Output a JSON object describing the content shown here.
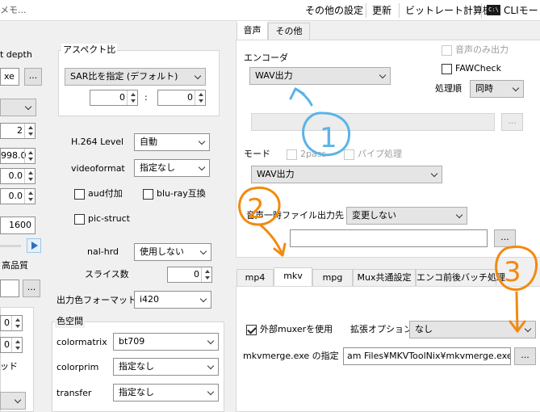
{
  "topbar": {
    "left_fragment": "メモ...",
    "buttons": [
      "その他の設定",
      "更新",
      "ビットレート計算機",
      "CLIモード"
    ],
    "cli_icon_text": "C:\\"
  },
  "left": {
    "bit_depth_label": "t depth",
    "exe_value": "xe",
    "browse": "...",
    "spin_values": [
      "2",
      "998.0",
      "0.0",
      "0.0"
    ],
    "field_1600": "1600",
    "quality_label": "高品質",
    "small_spins": [
      "0",
      "0"
    ],
    "thread_label": "ッド"
  },
  "aspect": {
    "group_label": "アスペクト比",
    "combo": "SAR比を指定 (デフォルト)",
    "spin_a": "0",
    "colon": ":",
    "spin_b": "0"
  },
  "h264": {
    "level_label": "H.264 Level",
    "level_value": "自動",
    "videoformat_label": "videoformat",
    "videoformat_value": "指定なし",
    "aud_label": "aud付加",
    "bluray_label": "blu-ray互換",
    "picstruct_label": "pic-struct",
    "nalhrd_label": "nal-hrd",
    "nalhrd_value": "使用しない",
    "slices_label": "スライス数",
    "slices_value": "0",
    "outcolor_label": "出力色フォーマット",
    "outcolor_value": "i420"
  },
  "colorspace": {
    "group_label": "色空間",
    "rows": [
      {
        "label": "colormatrix",
        "value": "bt709"
      },
      {
        "label": "colorprim",
        "value": "指定なし"
      },
      {
        "label": "transfer",
        "value": "指定なし"
      }
    ]
  },
  "audio": {
    "tabs": [
      "音声",
      "その他"
    ],
    "encoder_label": "エンコーダ",
    "encoder_value": "WAV出力",
    "audio_only_label": "音声のみ出力",
    "fawcheck_label": "FAWCheck",
    "order_label": "処理順",
    "order_value": "同時",
    "path_browse": "...",
    "mode_label": "モード",
    "twopass_label": "2pass",
    "pipe_label": "パイプ処理",
    "mode_value": "WAV出力",
    "temp_label": "音声一時ファイル出力先",
    "temp_value": "変更しない",
    "temp_browse": "..."
  },
  "mux": {
    "tabs": [
      "mp4",
      "mkv",
      "mpg",
      "Mux共通設定",
      "エンコ前後バッチ処理"
    ],
    "external_muxer_label": "外部muxerを使用",
    "ext_option_label": "拡張オプション",
    "ext_option_value": "なし",
    "mkvmerge_label": "mkvmerge.exe の指定",
    "mkvmerge_value": "am Files¥MKVToolNix¥mkvmerge.exe",
    "mkvmerge_browse": "..."
  },
  "annotations": {
    "num1": "1",
    "num2": "2",
    "num3": "3",
    "color_blue": "#5ab4e8",
    "color_orange": "#f28a10"
  }
}
